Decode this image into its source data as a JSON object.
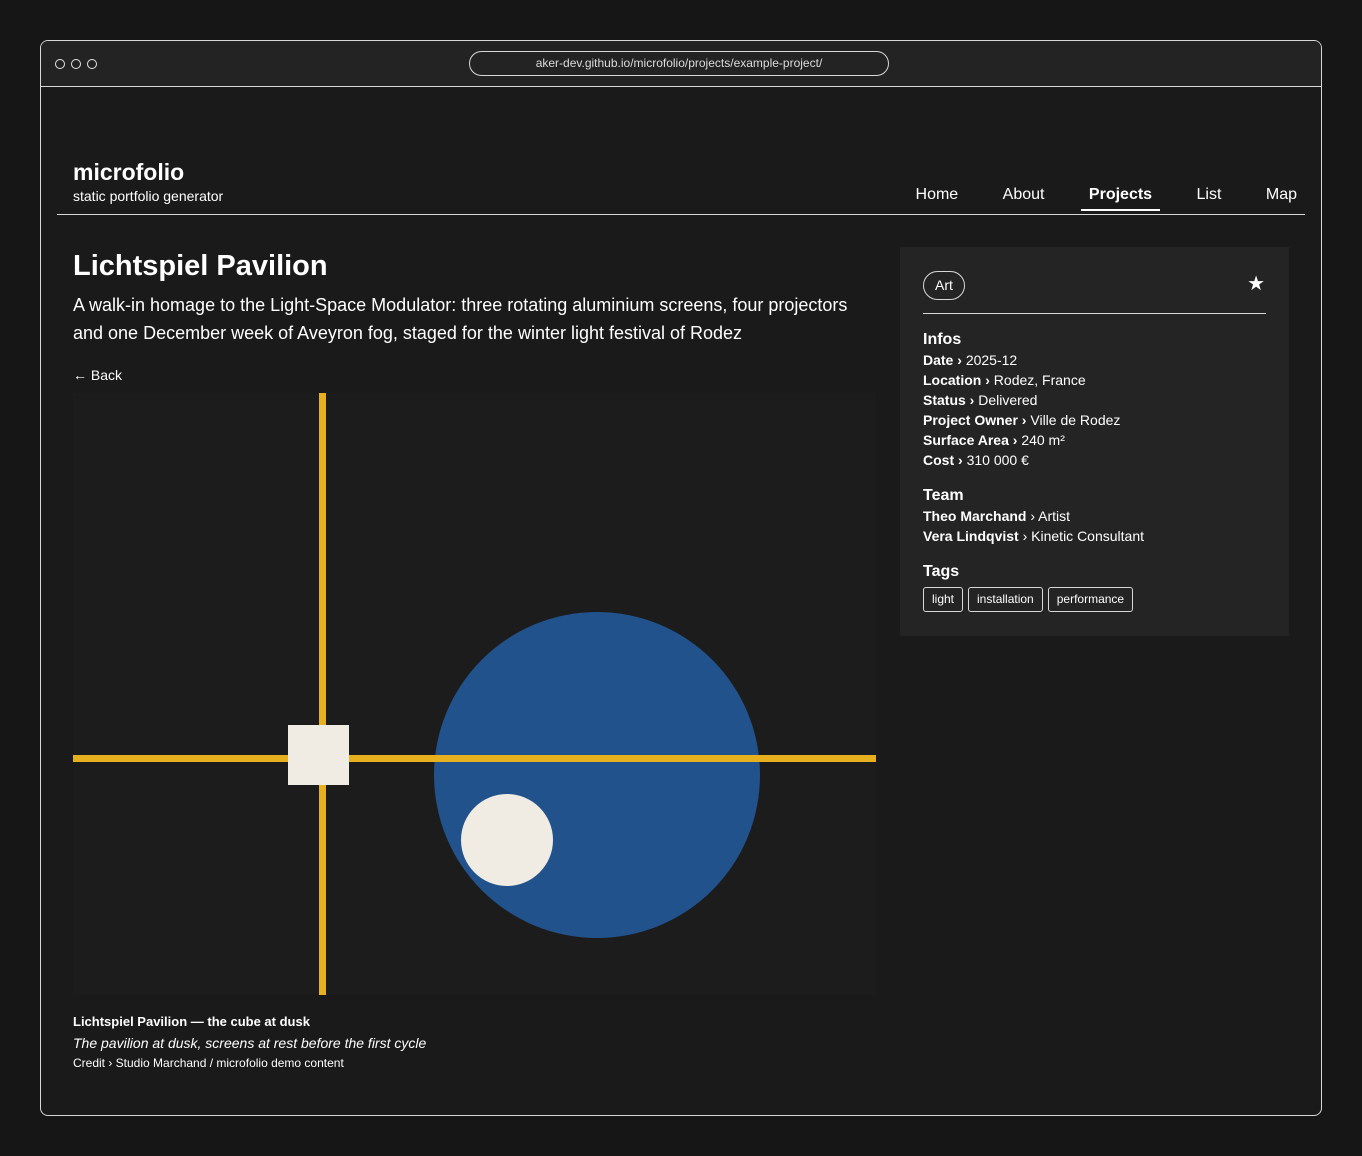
{
  "browser": {
    "url": "aker-dev.github.io/microfolio/projects/example-project/"
  },
  "header": {
    "site_title": "microfolio",
    "site_subtitle": "static portfolio generator",
    "nav": {
      "home": "Home",
      "about": "About",
      "projects": "Projects",
      "list": "List",
      "map": "Map"
    },
    "active_nav": "Projects"
  },
  "project": {
    "title": "Lichtspiel Pavilion",
    "description": "A walk-in homage to the Light-Space Modulator: three rotating aluminium screens, four projectors and one December week of Aveyron fog, staged for the winter light festival of Rodez",
    "back_label": "← Back",
    "caption": {
      "title": "Lichtspiel Pavilion — the cube at dusk",
      "description": "The pavilion at dusk, screens at rest before the first cycle",
      "credit": "Credit › Studio Marchand / microfolio demo content"
    },
    "image_colors": {
      "background": "#1c1c1c",
      "lines": "#e6b01e",
      "square": "#f0ece4",
      "big_circle": "#21528c",
      "small_circle": "#f0ece4"
    }
  },
  "sidebar": {
    "category": "Art",
    "favorite_icon": "star-icon",
    "infos_title": "Infos",
    "infos": [
      {
        "label": "Date",
        "value": "2025-12"
      },
      {
        "label": "Location",
        "value": "Rodez, France"
      },
      {
        "label": "Status",
        "value": "Delivered"
      },
      {
        "label": "Project Owner",
        "value": "Ville de Rodez"
      },
      {
        "label": "Surface Area",
        "value": "240 m²"
      },
      {
        "label": "Cost",
        "value": "310 000 €"
      }
    ],
    "separator": " › ",
    "team_title": "Team",
    "team": [
      {
        "name": "Theo Marchand",
        "role": "Artist"
      },
      {
        "name": "Vera Lindqvist",
        "role": "Kinetic Consultant"
      }
    ],
    "tags_title": "Tags",
    "tags": [
      "light",
      "installation",
      "performance"
    ]
  }
}
